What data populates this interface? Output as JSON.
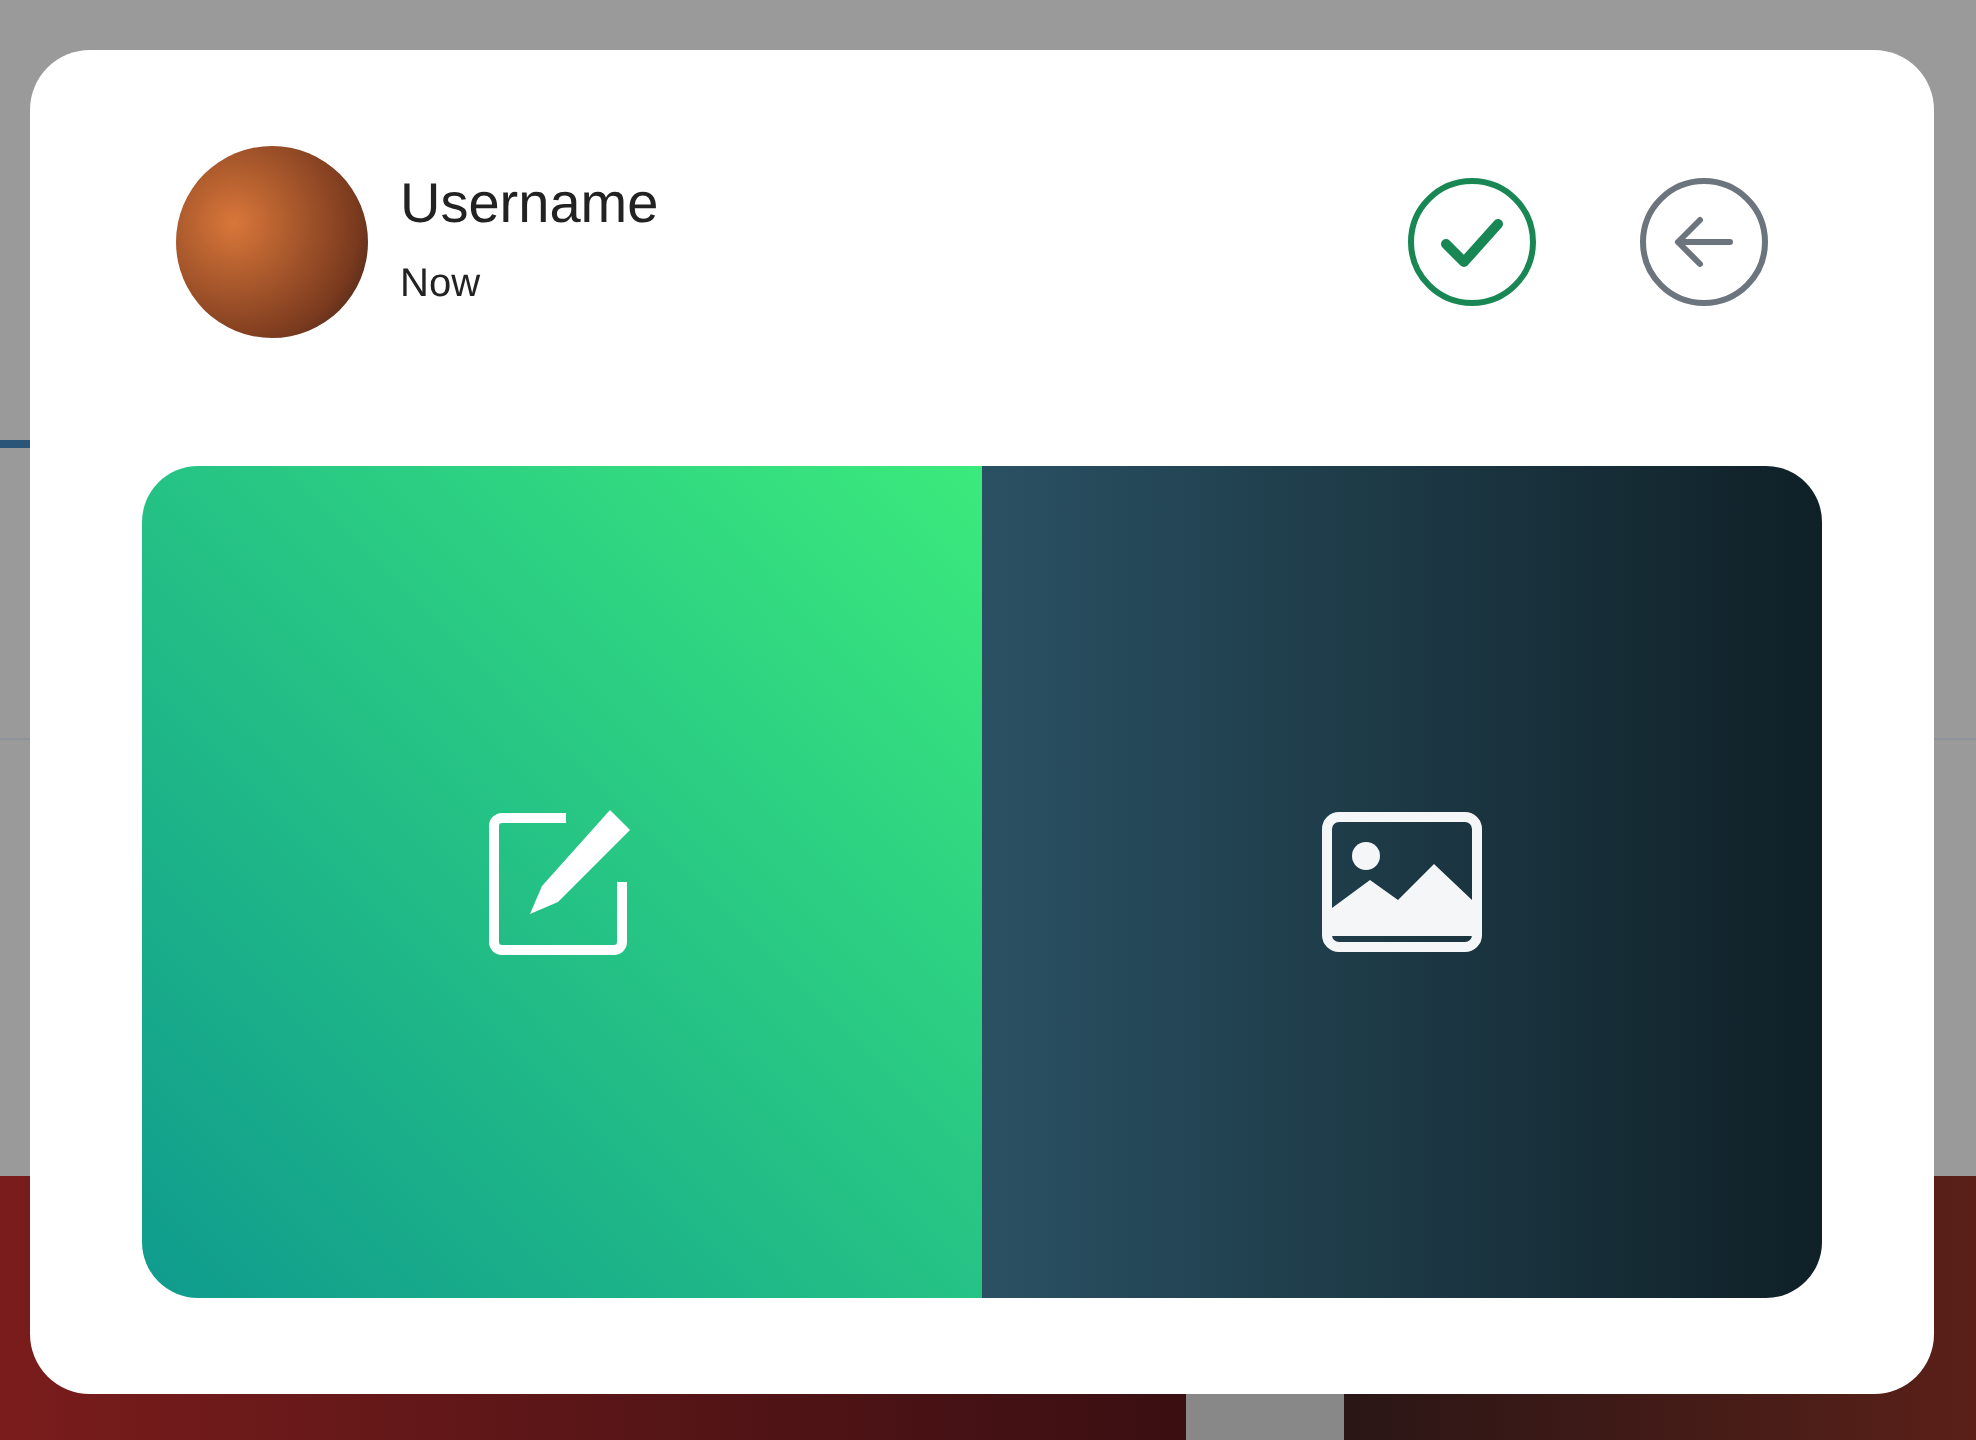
{
  "post": {
    "username": "Username",
    "time": "Now"
  },
  "actions": [
    {
      "kind": "confirm"
    },
    {
      "kind": "back"
    }
  ],
  "options": [
    {
      "kind": "text"
    },
    {
      "kind": "image"
    }
  ]
}
